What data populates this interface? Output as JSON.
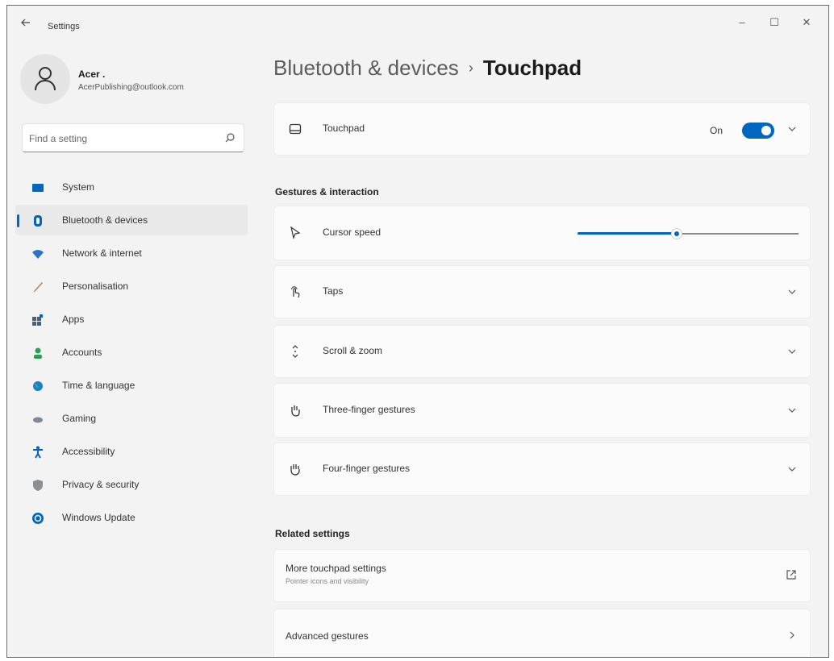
{
  "window": {
    "app_title": "Settings",
    "minimize_glyph": "–",
    "maximize_glyph": "☐",
    "close_glyph": "✕"
  },
  "profile": {
    "name": "Acer .",
    "email": "AcerPublishing@outlook.com"
  },
  "search": {
    "placeholder": "Find a setting"
  },
  "sidebar": {
    "items": [
      {
        "label": "System",
        "icon": "system-icon",
        "selected": false
      },
      {
        "label": "Bluetooth & devices",
        "icon": "bluetooth-icon",
        "selected": true
      },
      {
        "label": "Network & internet",
        "icon": "wifi-icon",
        "selected": false
      },
      {
        "label": "Personalisation",
        "icon": "brush-icon",
        "selected": false
      },
      {
        "label": "Apps",
        "icon": "apps-icon",
        "selected": false
      },
      {
        "label": "Accounts",
        "icon": "person-icon",
        "selected": false
      },
      {
        "label": "Time & language",
        "icon": "globe-clock-icon",
        "selected": false
      },
      {
        "label": "Gaming",
        "icon": "gamepad-icon",
        "selected": false
      },
      {
        "label": "Accessibility",
        "icon": "accessibility-icon",
        "selected": false
      },
      {
        "label": "Privacy & security",
        "icon": "shield-icon",
        "selected": false
      },
      {
        "label": "Windows Update",
        "icon": "update-icon",
        "selected": false
      }
    ]
  },
  "breadcrumb": {
    "parent": "Bluetooth & devices",
    "separator": "›",
    "current": "Touchpad"
  },
  "touchpad": {
    "label": "Touchpad",
    "toggle_text": "On",
    "toggle_on": true
  },
  "gestures": {
    "section_title": "Gestures & interaction",
    "cursor_speed_label": "Cursor speed",
    "cursor_speed_fraction": 0.45,
    "items": [
      {
        "label": "Taps"
      },
      {
        "label": "Scroll & zoom"
      },
      {
        "label": "Three-finger gestures"
      },
      {
        "label": "Four-finger gestures"
      }
    ]
  },
  "related": {
    "section_title": "Related settings",
    "more_title": "More touchpad settings",
    "more_subtitle": "Pointer icons and visibility",
    "advanced_title": "Advanced gestures"
  },
  "colors": {
    "accent": "#0067c0",
    "background": "#f3f3f3",
    "card": "#fbfbfb"
  }
}
